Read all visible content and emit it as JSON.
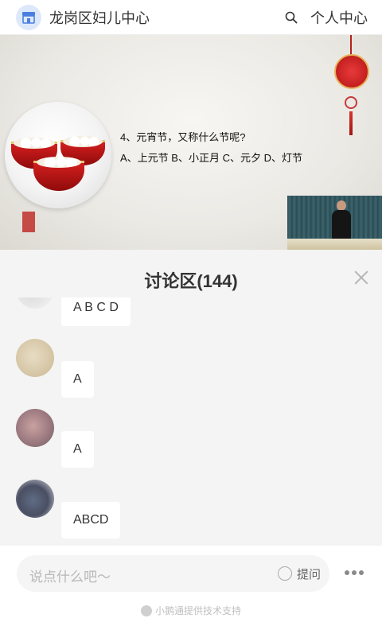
{
  "header": {
    "title": "龙岗区妇儿中心",
    "personal_center": "个人中心",
    "logo_icon": "store-icon",
    "search_icon": "search-icon"
  },
  "banner": {
    "question_line1": "4、元宵节，又称什么节呢?",
    "question_line2": "A、上元节 B、小正月 C、元夕  D、灯节"
  },
  "discussion": {
    "title": "讨论区(144)",
    "messages": [
      {
        "text": "A B C D"
      },
      {
        "text": "A"
      },
      {
        "text": "A"
      },
      {
        "text": "ABCD"
      }
    ]
  },
  "footer": {
    "input_placeholder": "说点什么吧～",
    "ask_label": "提问",
    "powered_by": "小鹅通提供技术支持"
  },
  "colors": {
    "accent": "#4a7fe0",
    "panel_bg": "#f4f4f4",
    "bowl_red": "#c81818"
  }
}
